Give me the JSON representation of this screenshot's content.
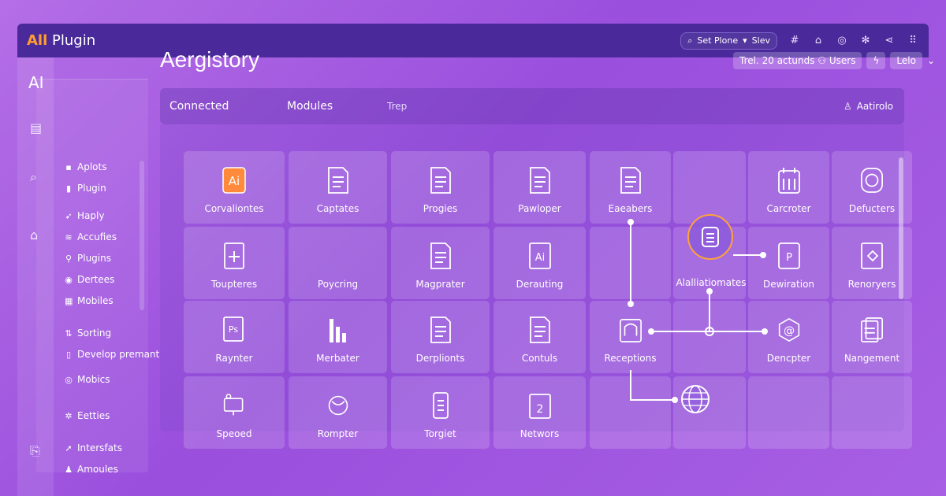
{
  "app": {
    "title_accent": "All",
    "title_rest": " Plugin"
  },
  "titlebar": {
    "search_label": "Set Plone",
    "select_label": "Slev"
  },
  "rail": {
    "logo": "AI"
  },
  "sidebar": {
    "items": [
      {
        "label": "Aplots",
        "icon": "cube-icon"
      },
      {
        "label": "Plugin",
        "icon": "square-icon"
      },
      {
        "label": "Haply",
        "icon": "pin-icon"
      },
      {
        "label": "Accufies",
        "icon": "layers-icon"
      },
      {
        "label": "Plugins",
        "icon": "plug-icon"
      },
      {
        "label": "Dertees",
        "icon": "circle-icon"
      },
      {
        "label": "Mobiles",
        "icon": "grid-icon"
      },
      {
        "label": "Sorting",
        "icon": "sort-icon"
      },
      {
        "label": "Develop premant",
        "icon": "code-icon"
      },
      {
        "label": "Mobics",
        "icon": "target-icon"
      },
      {
        "label": "Eetties",
        "icon": "star-icon"
      },
      {
        "label": "Intersfats",
        "icon": "arrow-icon"
      },
      {
        "label": "Amoules",
        "icon": "user-icon"
      }
    ]
  },
  "header": {
    "title": "Aergistory",
    "chip_main": "Trel. 20 actunds",
    "chip_users": "Users",
    "chip_help": "Lelo"
  },
  "tabs": {
    "connected": "Connected",
    "modules": "Modules",
    "trep": "Trep",
    "account": "Aatirolo"
  },
  "cards": [
    {
      "label": "Corvaliontes",
      "icon": "ai-icon"
    },
    {
      "label": "Captates",
      "icon": "document-icon"
    },
    {
      "label": "Progies",
      "icon": "chart-doc-icon"
    },
    {
      "label": "Pawloper",
      "icon": "page-icon"
    },
    {
      "label": "Eaeabers",
      "icon": "list-doc-icon"
    },
    {
      "label": "",
      "icon": ""
    },
    {
      "label": "Carcroter",
      "icon": "calendar-icon"
    },
    {
      "label": "Defucters",
      "icon": "badge-icon"
    },
    {
      "label": "Toupteres",
      "icon": "plus-doc-icon"
    },
    {
      "label": "Poycring",
      "icon": ""
    },
    {
      "label": "Magprater",
      "icon": "table-doc-icon"
    },
    {
      "label": "Derauting",
      "icon": "ai-doc-icon"
    },
    {
      "label": "",
      "icon": ""
    },
    {
      "label": "",
      "icon": ""
    },
    {
      "label": "Dewiration",
      "icon": "p-doc-icon"
    },
    {
      "label": "Renoryers",
      "icon": "tag-doc-icon"
    },
    {
      "label": "Raynter",
      "icon": "ps-icon"
    },
    {
      "label": "Merbater",
      "icon": "bars-icon"
    },
    {
      "label": "Derplionts",
      "icon": "text-doc-icon"
    },
    {
      "label": "Contuls",
      "icon": "stack-doc-icon"
    },
    {
      "label": "Receptions",
      "icon": "elephant-icon"
    },
    {
      "label": "",
      "icon": ""
    },
    {
      "label": "Dencpter",
      "icon": "at-icon"
    },
    {
      "label": "Nangement",
      "icon": "files-icon"
    },
    {
      "label": "Speoed",
      "icon": "monitor-icon"
    },
    {
      "label": "Rompter",
      "icon": "globe-doc-icon"
    },
    {
      "label": "Torgiet",
      "icon": "phone-icon"
    },
    {
      "label": "Networs",
      "icon": "number-doc-icon"
    },
    {
      "label": "",
      "icon": ""
    },
    {
      "label": "",
      "icon": ""
    },
    {
      "label": "",
      "icon": ""
    },
    {
      "label": "",
      "icon": ""
    }
  ],
  "hub": {
    "label": "Alalliatiomates",
    "icon": "document-hub-icon"
  },
  "colors": {
    "accent": "#ff9d2e",
    "titlebar": "#4a2a9a"
  }
}
